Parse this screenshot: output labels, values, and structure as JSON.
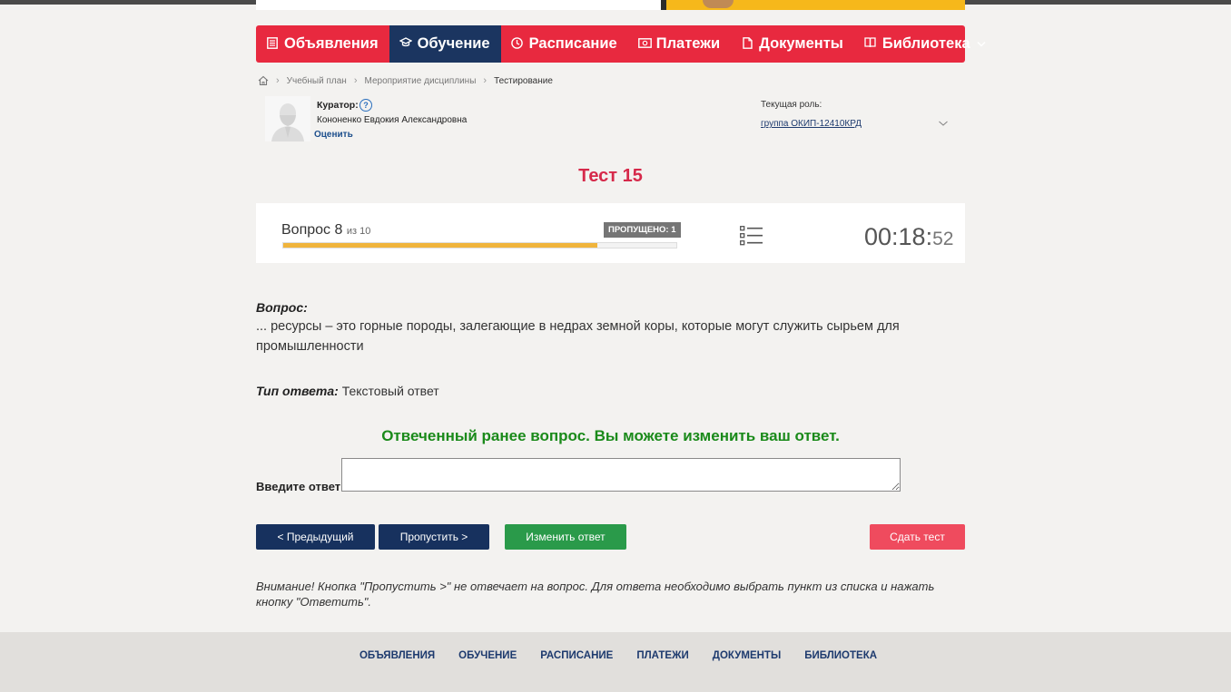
{
  "nav": {
    "items": [
      {
        "label": "Объявления",
        "icon": "list-icon"
      },
      {
        "label": "Обучение",
        "icon": "graduation-cap-icon"
      },
      {
        "label": "Расписание",
        "icon": "clock-icon"
      },
      {
        "label": "Платежи",
        "icon": "money-icon"
      },
      {
        "label": "Документы",
        "icon": "document-icon"
      },
      {
        "label": "Библиотека",
        "icon": "book-icon"
      }
    ],
    "active_index": 1
  },
  "breadcrumb": {
    "home_icon": "home-icon",
    "items": [
      "Учебный план",
      "Мероприятие дисциплины",
      "Тестирование"
    ]
  },
  "curator": {
    "label": "Куратор:",
    "name": "Кононенко Евдокия Александровна",
    "rate": "Оценить"
  },
  "role": {
    "label": "Текущая роль:",
    "value": "группа ОКИП-12410КРД"
  },
  "test": {
    "title": "Тест 15",
    "question_label": "Вопрос",
    "question_number": "8",
    "of_label": "из 10",
    "skipped": "ПРОПУЩЕНО: 1",
    "progress": 0.8,
    "timer_main": "00:18:",
    "timer_seconds": "52"
  },
  "question": {
    "label": "Вопрос:",
    "text": "... ресурсы – это горные породы, залегающие в недрах земной коры, которые могут служить сырьем для промышленности",
    "answer_type_label": "Тип ответа:",
    "answer_type": "Текстовый ответ",
    "answered_notice": "Отвеченный ранее вопрос. Вы можете изменить ваш ответ.",
    "input_label": "Введите ответ:",
    "input_value": ""
  },
  "buttons": {
    "prev": "< Предыдущий",
    "skip": "Пропустить >",
    "change": "Изменить ответ",
    "submit": "Сдать тест"
  },
  "warning": "Внимание! Кнопка \"Пропустить >\" не отвечает на вопрос. Для ответа необходимо выбрать пункт из списка и нажать кнопку \"Ответить\".",
  "footer": {
    "items": [
      "ОБЪЯВЛЕНИЯ",
      "ОБУЧЕНИЕ",
      "РАСПИСАНИЕ",
      "ПЛАТЕЖИ",
      "ДОКУМЕНТЫ",
      "БИБЛИОТЕКА"
    ]
  },
  "colors": {
    "nav_red": "#e8293f",
    "nav_active": "#1b3560",
    "title_red": "#d6294a",
    "progress": "#f0b43c",
    "notice_green": "#1a8a1a",
    "btn_navy": "#17315e",
    "btn_green": "#2a9a4a",
    "btn_red": "#ef4b5e"
  }
}
